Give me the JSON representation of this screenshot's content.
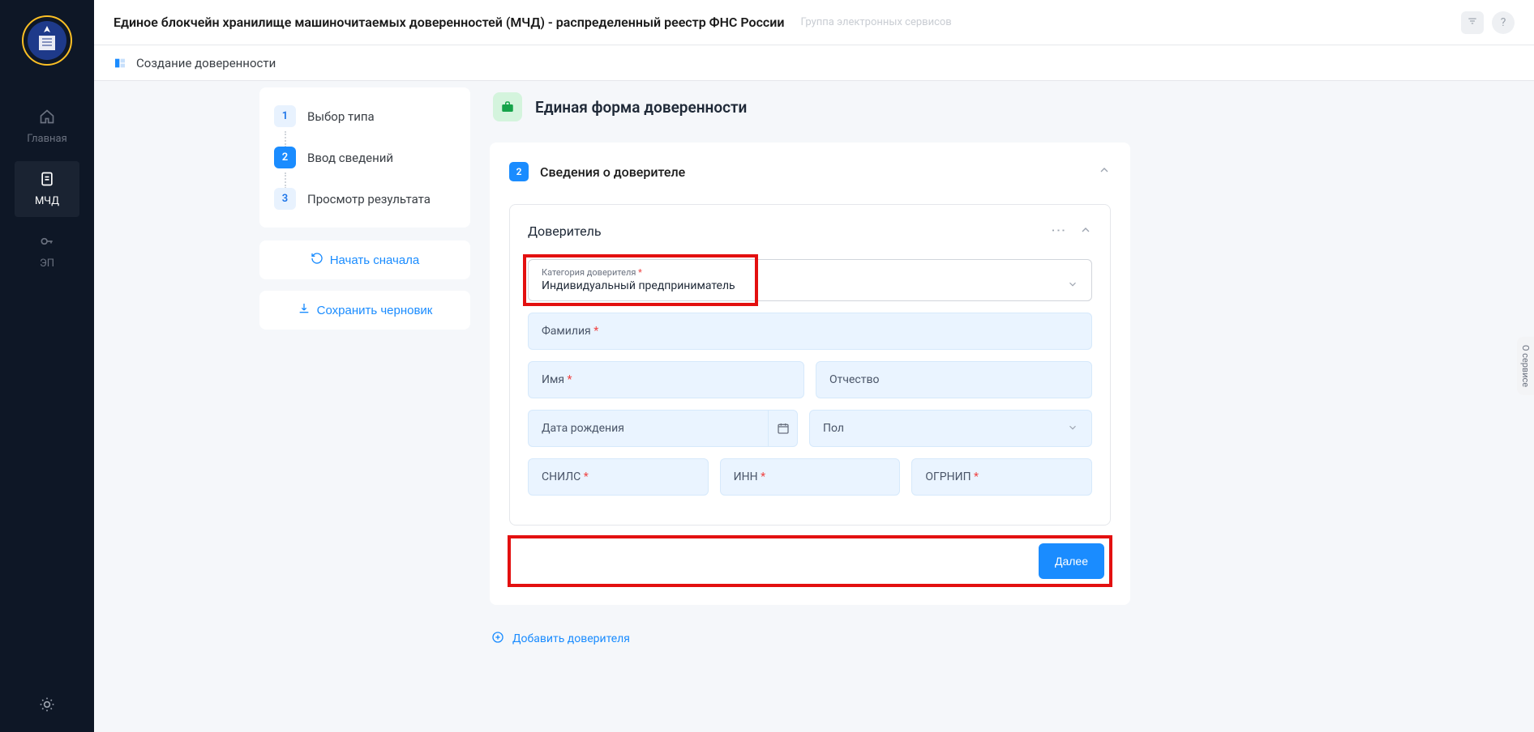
{
  "header": {
    "title": "Единое блокчейн хранилище машиночитаемых доверенностей (МЧД) - распределенный реестр ФНС России",
    "subtitle": "Группа электронных сервисов"
  },
  "sub_header": {
    "title": "Создание доверенности"
  },
  "sidebar": {
    "items": [
      {
        "label": "Главная",
        "icon": "home"
      },
      {
        "label": "МЧД",
        "icon": "doc"
      },
      {
        "label": "ЭП",
        "icon": "key"
      }
    ]
  },
  "stepper": {
    "items": [
      {
        "num": "1",
        "label": "Выбор типа"
      },
      {
        "num": "2",
        "label": "Ввод сведений"
      },
      {
        "num": "3",
        "label": "Просмотр результата"
      }
    ],
    "restart_label": "Начать сначала",
    "save_draft_label": "Сохранить черновик"
  },
  "form": {
    "title": "Единая форма доверенности",
    "section_num": "2",
    "section_title": "Сведения о доверителе",
    "subsection_title": "Доверитель",
    "category_label": "Категория доверителя",
    "category_value": "Индивидуальный предприниматель",
    "fields": {
      "surname": "Фамилия",
      "name": "Имя",
      "patronymic": "Отчество",
      "birthdate": "Дата рождения",
      "gender": "Пол",
      "snils": "СНИЛС",
      "inn": "ИНН",
      "ogrnip": "ОГРНИП"
    },
    "next_btn": "Далее",
    "add_trustor": "Добавить доверителя"
  },
  "about_tab": "О сервисе"
}
